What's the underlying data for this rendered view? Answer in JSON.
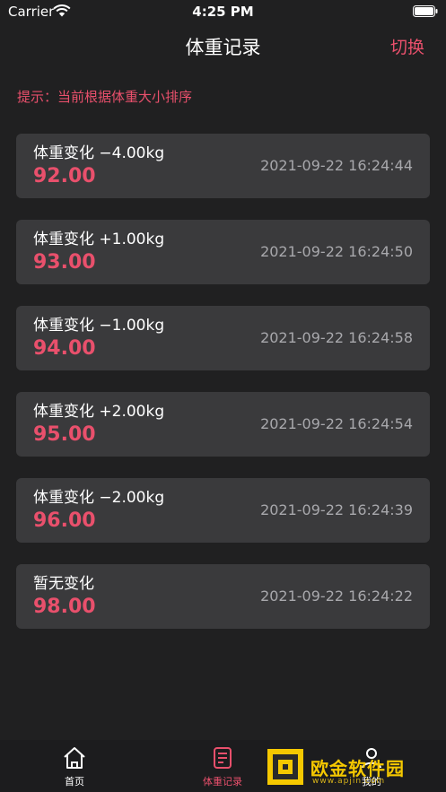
{
  "status_bar": {
    "carrier": "Carrier",
    "time": "4:25 PM"
  },
  "nav": {
    "title": "体重记录",
    "right_action": "切换"
  },
  "hint": "提示：当前根据体重大小排序",
  "records": [
    {
      "change": "体重变化 −4.00kg",
      "weight": "92.00",
      "time": "2021-09-22 16:24:44"
    },
    {
      "change": "体重变化 +1.00kg",
      "weight": "93.00",
      "time": "2021-09-22 16:24:50"
    },
    {
      "change": "体重变化 −1.00kg",
      "weight": "94.00",
      "time": "2021-09-22 16:24:58"
    },
    {
      "change": "体重变化 +2.00kg",
      "weight": "95.00",
      "time": "2021-09-22 16:24:54"
    },
    {
      "change": "体重变化 −2.00kg",
      "weight": "96.00",
      "time": "2021-09-22 16:24:39"
    },
    {
      "change": "暂无变化",
      "weight": "98.00",
      "time": "2021-09-22 16:24:22"
    }
  ],
  "tabs": [
    {
      "label": "首页",
      "icon": "home-icon"
    },
    {
      "label": "体重记录",
      "icon": "document-icon",
      "active": true
    },
    {
      "label": "我的",
      "icon": "profile-icon"
    }
  ],
  "watermark": {
    "text": "欧金软件园",
    "url": "www.apjin.com"
  },
  "colors": {
    "background": "#202021",
    "card": "#3a3a3c",
    "accent": "#e9506c",
    "muted": "#a8a8ac"
  }
}
